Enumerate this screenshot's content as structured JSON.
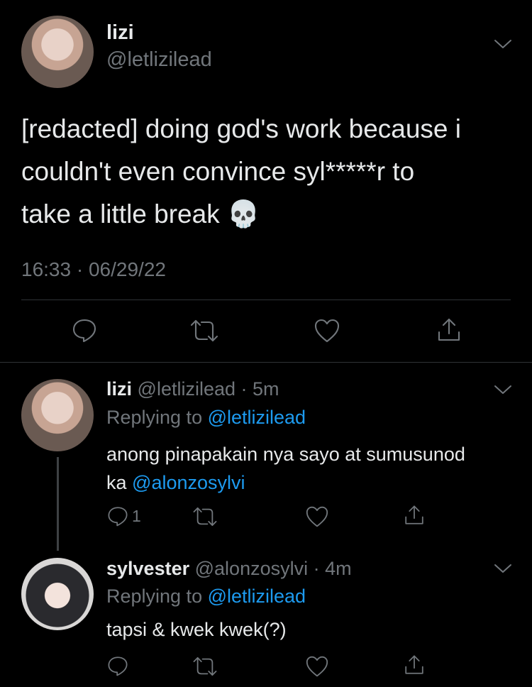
{
  "main_tweet": {
    "name": "lizi",
    "handle": "@letlizilead",
    "text_lines": [
      "[redacted] doing god's work because i",
      "couldn't even convince syl*****r to",
      "take a little break 💀"
    ],
    "time": "16:33",
    "separator": "·",
    "date": "06/29/22"
  },
  "reply1": {
    "name": "lizi",
    "handle": "@letlizilead",
    "age": "· 5m",
    "replying_prefix": "Replying to",
    "replying_handle": "@letlizilead",
    "text_line1": "anong pinapakain nya sayo at sumusunod",
    "text_line2_prefix": "ka",
    "text_mention": "@alonzosylvi",
    "reply_count": "1"
  },
  "reply2": {
    "name": "sylvester",
    "handle": "@alonzosylvi",
    "age": "· 4m",
    "replying_prefix": "Replying to",
    "replying_handle": "@letlizilead",
    "text": "tapsi & kwek kwek(?)"
  },
  "icons": {
    "reply": "reply-icon",
    "retweet": "retweet-icon",
    "like": "heart-icon",
    "share": "share-icon",
    "more": "chevron-down-icon"
  },
  "colors": {
    "background": "#000000",
    "text": "#e7e9ea",
    "muted": "#71767b",
    "link": "#1d9bf0"
  }
}
